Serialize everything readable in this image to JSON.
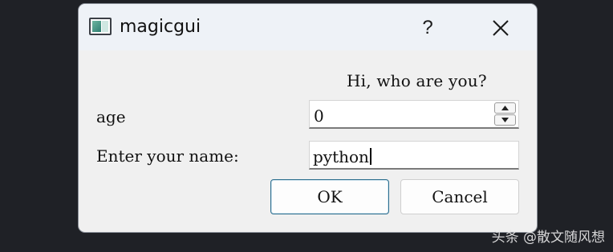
{
  "window": {
    "title": "magicgui",
    "help_label": "?",
    "icon": "app-window-icon",
    "close_icon": "close-icon"
  },
  "form": {
    "greeting": "Hi, who are you?",
    "age_label": "age",
    "age_value": "0",
    "name_label": "Enter your name:",
    "name_value": "python"
  },
  "buttons": {
    "ok_label": "OK",
    "cancel_label": "Cancel"
  },
  "watermark": {
    "text": "头条 @散文随风想"
  },
  "colors": {
    "background": "#1f2126",
    "dialog": "#f0f0f0",
    "titlebar": "#eef2f7",
    "ok_border": "#2d6e8e"
  }
}
